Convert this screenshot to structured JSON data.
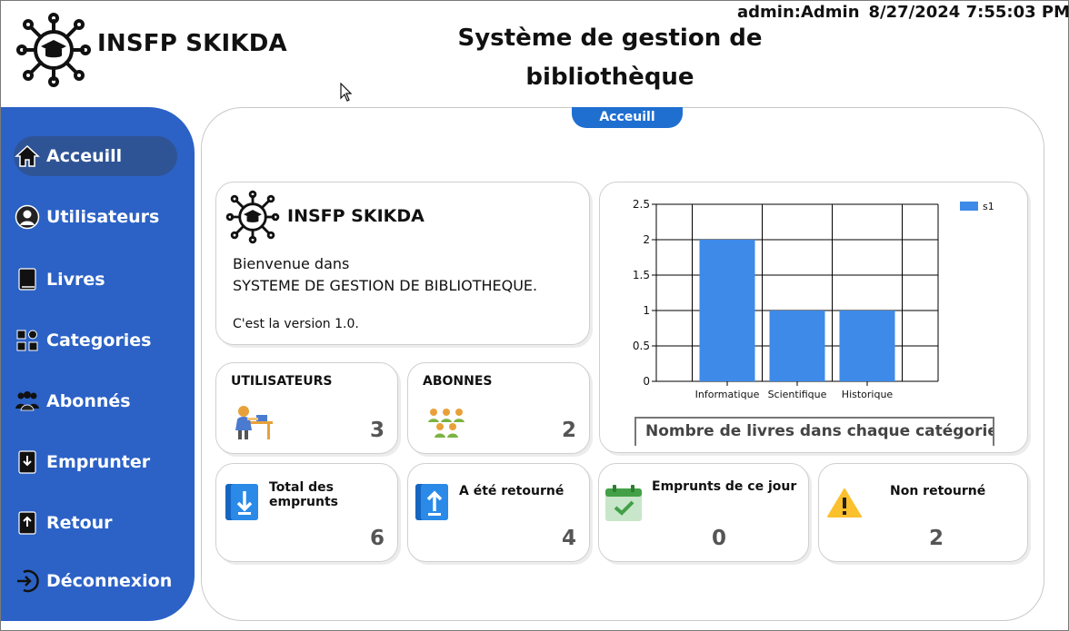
{
  "header": {
    "brand": "INSFP SKIKDA",
    "title_line1": "Système de gestion de",
    "title_line2": "bibliothèque",
    "user": "admin:Admin",
    "datetime": "8/27/2024 7:55:03 PM"
  },
  "sidebar": {
    "items": [
      {
        "label": "Acceuill",
        "icon": "home-icon",
        "active": true
      },
      {
        "label": "Utilisateurs",
        "icon": "user-icon"
      },
      {
        "label": "Livres",
        "icon": "book-icon"
      },
      {
        "label": "Categories",
        "icon": "categories-icon"
      },
      {
        "label": "Abonnés",
        "icon": "group-icon"
      },
      {
        "label": "Emprunter",
        "icon": "borrow-icon"
      },
      {
        "label": "Retour",
        "icon": "return-icon"
      },
      {
        "label": "Déconnexion",
        "icon": "logout-icon"
      }
    ]
  },
  "main": {
    "tab_label": "Acceuill",
    "welcome": {
      "brand": "INSFP SKIKDA",
      "line1": "Bienvenue dans",
      "line2": "SYSTEME DE GESTION DE BIBLIOTHEQUE.",
      "line3": "C'est la version 1.0."
    },
    "stats": {
      "utilisateurs": {
        "label": "UTILISATEURS",
        "value": "3"
      },
      "abonnes": {
        "label": "ABONNES",
        "value": "2"
      },
      "total_emprunts": {
        "label": "Total des emprunts",
        "value": "6"
      },
      "retourne": {
        "label": "A été retourné",
        "value": "4"
      },
      "emprunts_jour": {
        "label": "Emprunts de ce jour",
        "value": "0"
      },
      "non_retourne": {
        "label": "Non retourné",
        "value": "2"
      }
    },
    "chart_caption": "Nombre de livres dans chaque catégorie"
  },
  "colors": {
    "sidebar": "#2c62c6",
    "active_item": "#2f5496",
    "accent": "#1f6fd1",
    "bar": "#3d8ae8"
  },
  "chart_data": {
    "type": "bar",
    "categories": [
      "Informatique",
      "Scientifique",
      "Historique"
    ],
    "series": [
      {
        "name": "s1",
        "values": [
          2,
          1,
          1
        ]
      }
    ],
    "ylim": [
      0,
      2.5
    ],
    "yticks": [
      "0",
      "0.5",
      "1",
      "1.5",
      "2",
      "2.5"
    ],
    "grid": true,
    "legend": "top-right",
    "title": "",
    "xlabel": "",
    "ylabel": ""
  }
}
